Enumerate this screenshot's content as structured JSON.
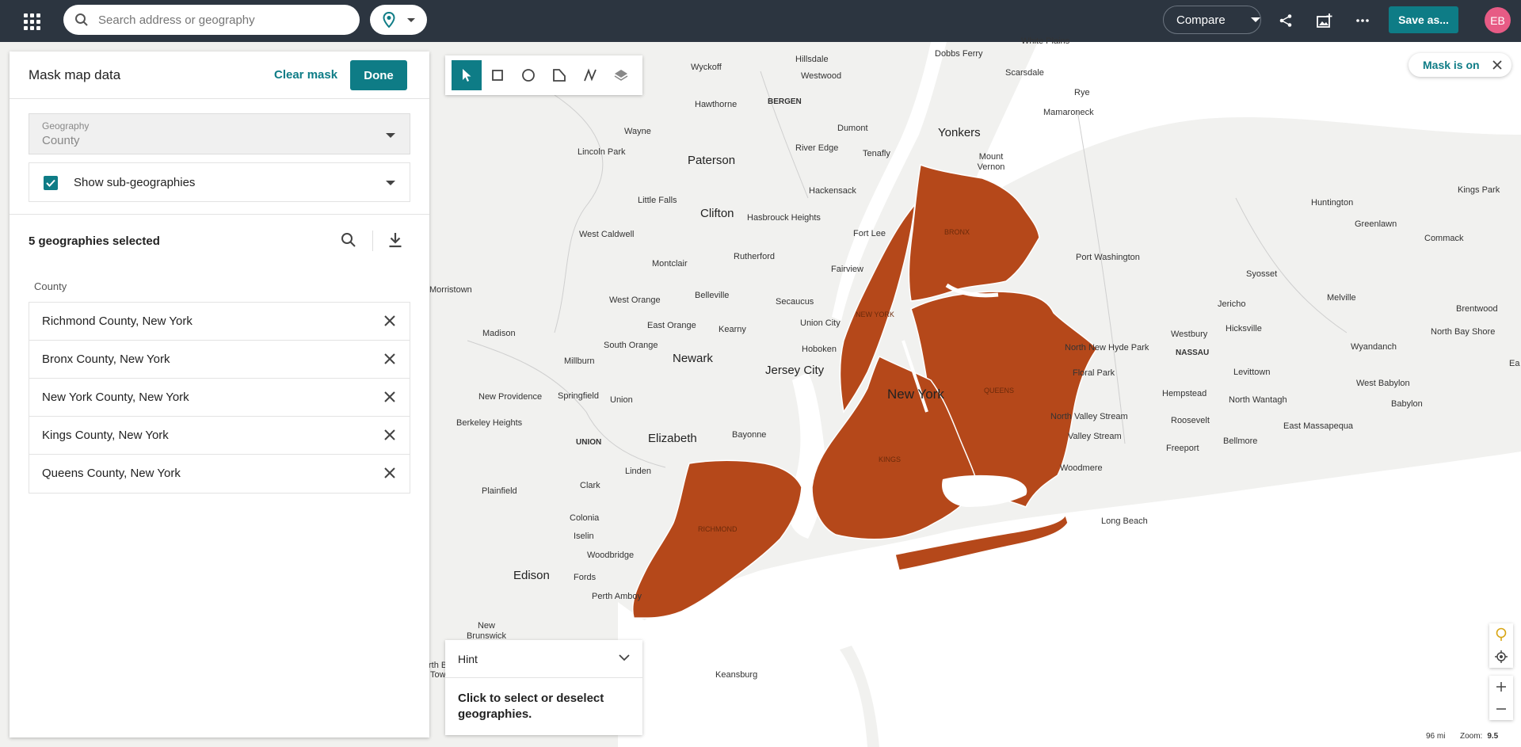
{
  "topbar": {
    "search_placeholder": "Search address or geography",
    "compare_label": "Compare",
    "save_as_label": "Save as...",
    "avatar_initials": "EB",
    "icons": [
      "apps-grid-icon",
      "search-icon",
      "location-pin-icon",
      "share-icon",
      "add-image-icon",
      "more-icon"
    ]
  },
  "panel": {
    "title": "Mask map data",
    "clear_mask_label": "Clear mask",
    "done_label": "Done",
    "geography_label": "Geography",
    "geography_value": "County",
    "show_subgeo_label": "Show sub-geographies",
    "show_subgeo_checked": true,
    "selected_count_label": "5 geographies selected",
    "column_header": "County",
    "geographies": [
      {
        "name": "Richmond County, New York"
      },
      {
        "name": "Bronx County, New York"
      },
      {
        "name": "New York County, New York"
      },
      {
        "name": "Kings County, New York"
      },
      {
        "name": "Queens County, New York"
      }
    ]
  },
  "map": {
    "mask_label": "Mask is on",
    "hint_title": "Hint",
    "hint_text": "Click to select or deselect geographies.",
    "scale_label": "96 mi",
    "zoom_label": "Zoom:",
    "zoom_value": "9.5",
    "mask_color": "#b5481a",
    "accent_color": "#0e7c86",
    "tools": [
      "select-pointer-icon",
      "rectangle-tool-icon",
      "circle-tool-icon",
      "polygon-tool-icon",
      "line-tool-icon",
      "layers-icon"
    ],
    "county_labels": {
      "bronx": "BRONX",
      "new_york": "NEW YORK",
      "queens": "QUEENS",
      "kings": "KINGS",
      "richmond": "RICHMOND"
    },
    "places": {
      "white_plains": "White Plains",
      "dobbs_ferry": "Dobbs Ferry",
      "hillsdale": "Hillsdale",
      "wyckoff": "Wyckoff",
      "westwood": "Westwood",
      "scarsdale": "Scarsdale",
      "rye": "Rye",
      "mamaroneck": "Mamaroneck",
      "hawthorne": "Hawthorne",
      "bergen": "BERGEN",
      "wayne": "Wayne",
      "dumont": "Dumont",
      "yonkers": "Yonkers",
      "lincoln_park": "Lincoln Park",
      "paterson": "Paterson",
      "river_edge": "River Edge",
      "tenafly": "Tenafly",
      "mount_vernon": "Mount Vernon",
      "hackensack": "Hackensack",
      "little_falls": "Little Falls",
      "clifton": "Clifton",
      "hasbrouck_heights": "Hasbrouck Heights",
      "west_caldwell": "West Caldwell",
      "fort_lee": "Fort Lee",
      "rutherford": "Rutherford",
      "montclair": "Montclair",
      "fairview": "Fairview",
      "port_washington": "Port Washington",
      "morristown": "Morristown",
      "west_orange": "West Orange",
      "belleville": "Belleville",
      "secaucus": "Secaucus",
      "east_orange": "East Orange",
      "kearny": "Kearny",
      "union_city": "Union City",
      "madison": "Madison",
      "south_orange": "South Orange",
      "hoboken": "Hoboken",
      "millburn": "Millburn",
      "newark": "Newark",
      "jersey_city": "Jersey City",
      "new_york_city": "New York",
      "new_providence": "New Providence",
      "springfield": "Springfield",
      "union": "Union",
      "berkeley_heights": "Berkeley Heights",
      "union_county": "UNION",
      "elizabeth": "Elizabeth",
      "bayonne": "Bayonne",
      "linden": "Linden",
      "clark": "Clark",
      "plainfield": "Plainfield",
      "colonia": "Colonia",
      "iselin": "Iselin",
      "woodbridge": "Woodbridge",
      "edison": "Edison",
      "fords": "Fords",
      "perth_amboy": "Perth Amboy",
      "new_brunswick": "New Brunswick",
      "keansburg": "Keansburg",
      "huntington": "Huntington",
      "kings_park": "Kings Park",
      "greenlawn": "Greenlawn",
      "commack": "Commack",
      "syosset": "Syosset",
      "melville": "Melville",
      "jericho": "Jericho",
      "brentwood": "Brentwood",
      "westbury": "Westbury",
      "hicksville": "Hicksville",
      "north_bay_shore": "North Bay Shore",
      "north_new_hyde_park": "North New Hyde Park",
      "nassau": "NASSAU",
      "wyandanch": "Wyandanch",
      "floral_park": "Floral Park",
      "levittown": "Levittown",
      "west_babylon": "West Babylon",
      "hempstead": "Hempstead",
      "north_wantagh": "North Wantagh",
      "babylon": "Babylon",
      "north_valley_stream": "North Valley Stream",
      "roosevelt": "Roosevelt",
      "east_massapequa": "East Massapequa",
      "valley_stream": "Valley Stream",
      "freeport": "Freeport",
      "bellmore": "Bellmore",
      "woodmere": "Woodmere",
      "long_beach": "Long Beach",
      "ea": "Ea",
      "rth_b": "rth B",
      "tov": "Tow"
    }
  }
}
